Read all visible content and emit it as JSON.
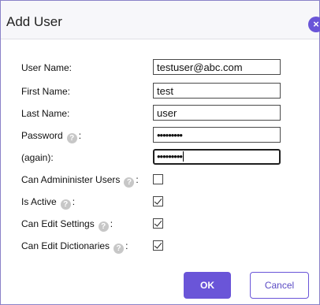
{
  "dialog": {
    "title": "Add User",
    "close_icon": "×"
  },
  "help_icon": "?",
  "fields": {
    "user_name": {
      "label": "User Name:",
      "value": "testuser@abc.com"
    },
    "first_name": {
      "label": "First Name:",
      "value": "test"
    },
    "last_name": {
      "label": "Last Name:",
      "value": "user"
    },
    "password": {
      "label": "Password",
      "suffix": ":",
      "value": "•••••••••"
    },
    "password_again": {
      "label": "(again):",
      "value": "•••••••••"
    }
  },
  "checkboxes": {
    "can_administer_users": {
      "label": "Can Admininister Users",
      "suffix": ":",
      "checked": false
    },
    "is_active": {
      "label": "Is Active",
      "suffix": ":",
      "checked": true
    },
    "can_edit_settings": {
      "label": "Can Edit Settings",
      "suffix": ":",
      "checked": true
    },
    "can_edit_dictionaries": {
      "label": "Can Edit Dictionaries",
      "suffix": ":",
      "checked": true
    }
  },
  "buttons": {
    "ok": "OK",
    "cancel": "Cancel"
  },
  "colors": {
    "accent": "#6a55d8",
    "border": "#8a82c8"
  }
}
